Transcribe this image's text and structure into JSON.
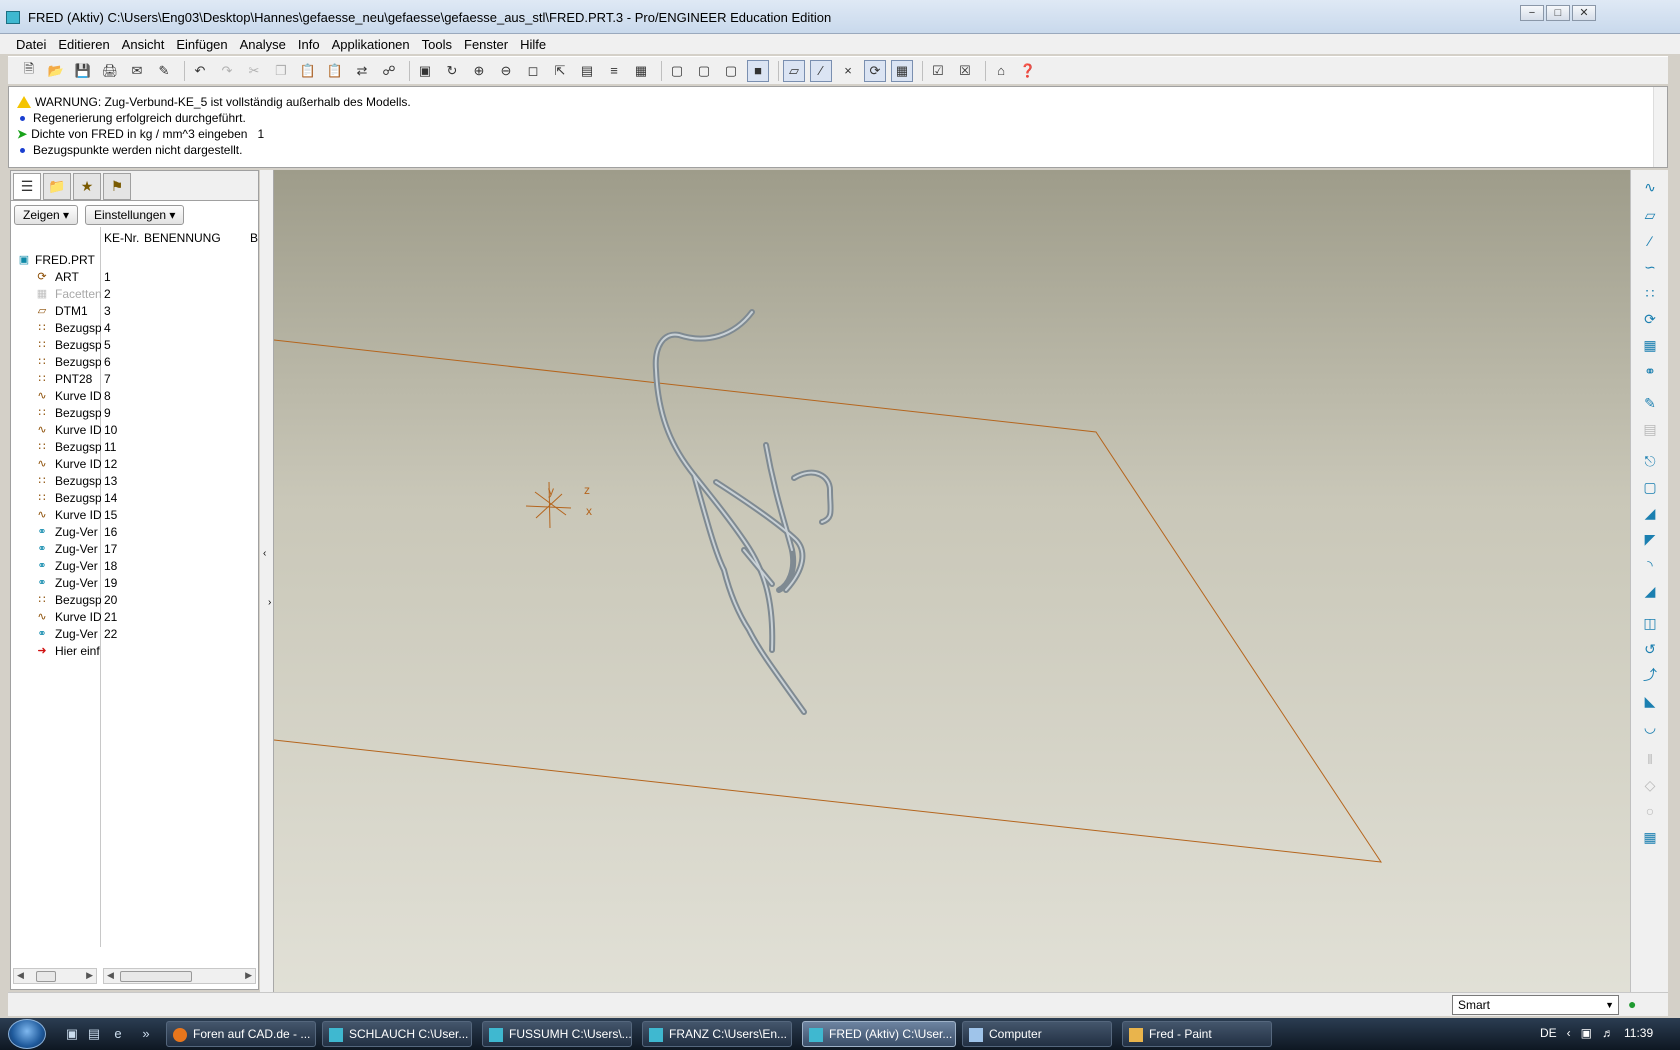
{
  "window": {
    "title": "FRED (Aktiv) C:\\Users\\Eng03\\Desktop\\Hannes\\gefaesse_neu\\gefaesse\\gefaesse_aus_stl\\FRED.PRT.3 - Pro/ENGINEER Education Edition",
    "controls": [
      "−",
      "□",
      "✕"
    ]
  },
  "menu": [
    "Datei",
    "Editieren",
    "Ansicht",
    "Einfügen",
    "Analyse",
    "Info",
    "Applikationen",
    "Tools",
    "Fenster",
    "Hilfe"
  ],
  "messages": {
    "warning": "WARNUNG: Zug-Verbund-KE_5 ist vollständig außerhalb des Modells.",
    "regen": "Regenerierung erfolgreich durchgeführt.",
    "prompt": "Dichte von FRED in kg / mm^3 eingeben",
    "prompt_value": "1",
    "datum": "Bezugspunkte werden nicht dargestellt."
  },
  "model_tree": {
    "buttons": {
      "show": "Zeigen",
      "settings": "Einstellungen"
    },
    "columns": {
      "ke_nr": "KE-Nr.",
      "name": "BENENNUNG",
      "b": "B"
    },
    "root": "FRED.PRT",
    "items": [
      {
        "name": "ART",
        "num": "1",
        "icon": "csys-icon"
      },
      {
        "name": "Facetten",
        "num": "2",
        "icon": "facet-icon"
      },
      {
        "name": "DTM1",
        "num": "3",
        "icon": "plane-icon"
      },
      {
        "name": "Bezugsp",
        "num": "4",
        "icon": "point-icon"
      },
      {
        "name": "Bezugsp",
        "num": "5",
        "icon": "point-icon"
      },
      {
        "name": "Bezugsp",
        "num": "6",
        "icon": "point-icon"
      },
      {
        "name": "PNT28",
        "num": "7",
        "icon": "point-icon"
      },
      {
        "name": "Kurve ID",
        "num": "8",
        "icon": "curve-icon"
      },
      {
        "name": "Bezugsp",
        "num": "9",
        "icon": "point-icon"
      },
      {
        "name": "Kurve ID",
        "num": "10",
        "icon": "curve-icon"
      },
      {
        "name": "Bezugsp",
        "num": "11",
        "icon": "point-icon"
      },
      {
        "name": "Kurve ID",
        "num": "12",
        "icon": "curve-icon"
      },
      {
        "name": "Bezugsp",
        "num": "13",
        "icon": "point-icon"
      },
      {
        "name": "Bezugsp",
        "num": "14",
        "icon": "point-icon"
      },
      {
        "name": "Kurve ID",
        "num": "15",
        "icon": "curve-icon"
      },
      {
        "name": "Zug-Ver",
        "num": "16",
        "icon": "sweep-icon"
      },
      {
        "name": "Zug-Ver",
        "num": "17",
        "icon": "sweep-icon"
      },
      {
        "name": "Zug-Ver",
        "num": "18",
        "icon": "sweep-icon"
      },
      {
        "name": "Zug-Ver",
        "num": "19",
        "icon": "sweep-icon"
      },
      {
        "name": "Bezugsp",
        "num": "20",
        "icon": "point-icon"
      },
      {
        "name": "Kurve ID",
        "num": "21",
        "icon": "curve-icon"
      },
      {
        "name": "Zug-Ver",
        "num": "22",
        "icon": "sweep-icon"
      },
      {
        "name": "Hier einf",
        "num": "",
        "icon": "insert-here-icon"
      }
    ]
  },
  "csys_labels": {
    "y": "y",
    "z": "z",
    "x": "x"
  },
  "status": {
    "filter": "Smart"
  },
  "taskbar": {
    "items": [
      {
        "label": "Foren auf CAD.de - ...",
        "icon": "firefox-icon"
      },
      {
        "label": "SCHLAUCH C:\\User...",
        "icon": "proe-icon"
      },
      {
        "label": "FUSSUMH C:\\Users\\...",
        "icon": "proe-icon"
      },
      {
        "label": "FRANZ C:\\Users\\En...",
        "icon": "proe-icon"
      },
      {
        "label": "FRED (Aktiv) C:\\User...",
        "icon": "proe-icon"
      },
      {
        "label": "Computer",
        "icon": "computer-icon"
      },
      {
        "label": "Fred - Paint",
        "icon": "paint-icon"
      }
    ],
    "language": "DE",
    "clock": "11:39"
  }
}
